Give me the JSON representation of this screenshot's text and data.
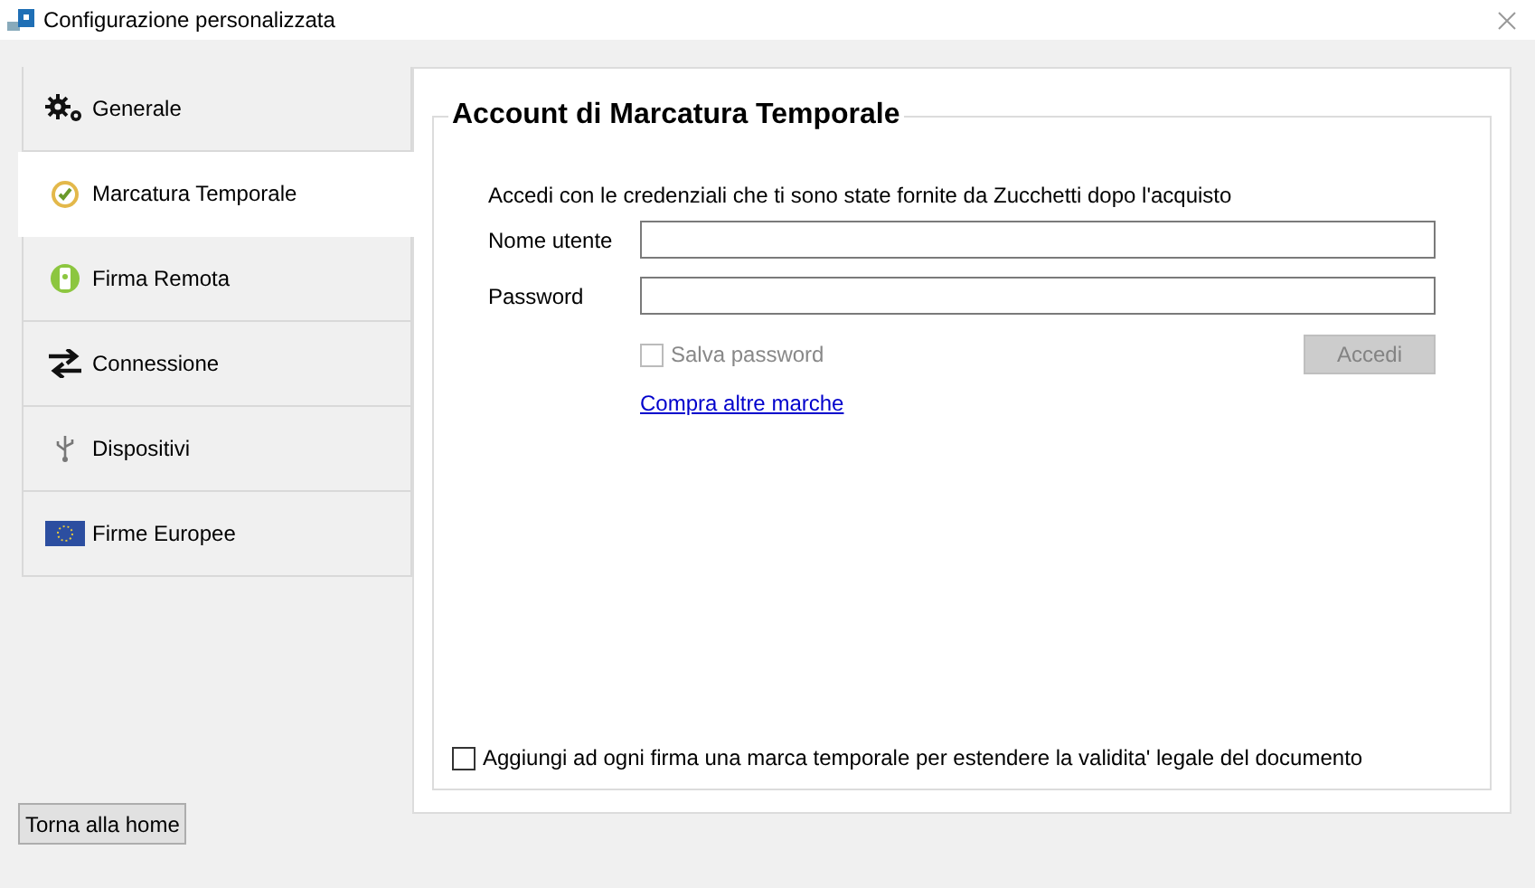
{
  "window": {
    "title": "Configurazione personalizzata"
  },
  "sidebar": {
    "items": [
      {
        "label": "Generale",
        "selected": false
      },
      {
        "label": "Marcatura Temporale",
        "selected": true
      },
      {
        "label": "Firma Remota",
        "selected": false
      },
      {
        "label": "Connessione",
        "selected": false
      },
      {
        "label": "Dispositivi",
        "selected": false
      },
      {
        "label": "Firme Europee",
        "selected": false
      }
    ]
  },
  "panel": {
    "title": "Account di Marcatura Temporale",
    "intro": "Accedi con le credenziali che ti sono state fornite da Zucchetti dopo l'acquisto",
    "fields": [
      {
        "label": "Nome utente"
      },
      {
        "label": "Password"
      }
    ],
    "save_password": {
      "label": "Salva password",
      "checked": false,
      "disabled": true
    },
    "login_button": {
      "label": "Accedi",
      "disabled": true
    },
    "link": "Compra altre marche",
    "timestamp_option": {
      "label": "Aggiungi ad ogni firma una marca temporale per estendere la validita' legale del documento",
      "checked": false,
      "disabled": false
    }
  },
  "home_button": "Torna alla home"
}
